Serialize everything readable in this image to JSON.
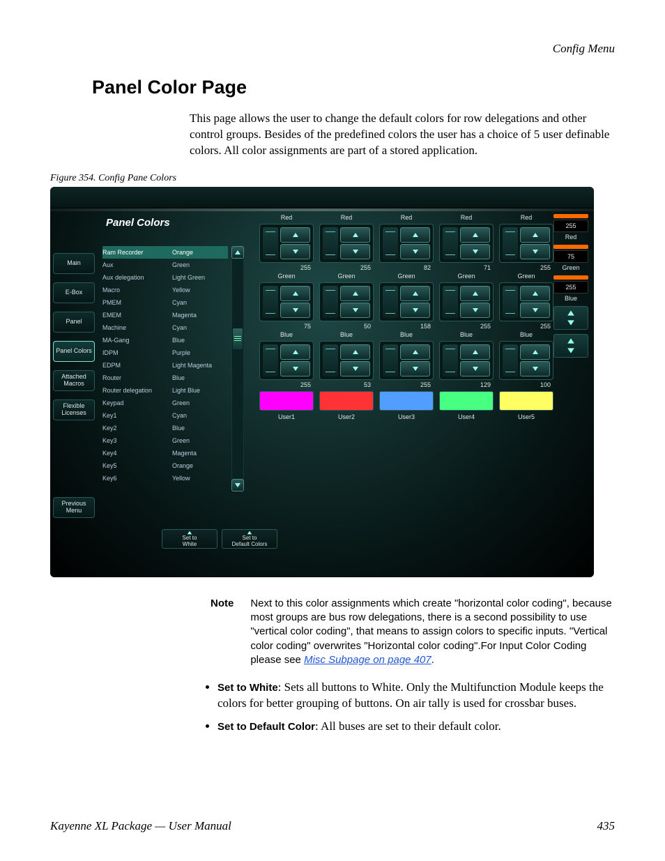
{
  "header": "Config Menu",
  "title": "Panel Color Page",
  "intro": "This page allows the user to change the default colors for row delegations and other control groups. Besides of the predefined colors the user has a choice of 5 user definable colors. All color assignments are part of a stored application.",
  "figure_caption": "Figure 354.  Config Pane Colors",
  "shot": {
    "panel_title": "Panel Colors",
    "left_tabs": [
      "Main",
      "E-Box",
      "Panel",
      "Panel Colors",
      "Attached Macros",
      "Flexible Licenses"
    ],
    "prev_tab": "Previous Menu",
    "list": [
      {
        "name": "Ram Recorder",
        "color": "Orange",
        "hi": true
      },
      {
        "name": "Aux",
        "color": "Green"
      },
      {
        "name": "Aux delegation",
        "color": "Light Green"
      },
      {
        "name": "Macro",
        "color": "Yellow"
      },
      {
        "name": "PMEM",
        "color": "Cyan"
      },
      {
        "name": "EMEM",
        "color": "Magenta"
      },
      {
        "name": "Machine",
        "color": "Cyan"
      },
      {
        "name": "MA-Gang",
        "color": "Blue"
      },
      {
        "name": "IDPM",
        "color": "Purple"
      },
      {
        "name": "EDPM",
        "color": "Light Magenta"
      },
      {
        "name": "Router",
        "color": "Blue"
      },
      {
        "name": "Router delegation",
        "color": "Light Blue"
      },
      {
        "name": "Keypad",
        "color": "Green"
      },
      {
        "name": "Key1",
        "color": "Cyan"
      },
      {
        "name": "Key2",
        "color": "Blue"
      },
      {
        "name": "Key3",
        "color": "Green"
      },
      {
        "name": "Key4",
        "color": "Magenta"
      },
      {
        "name": "Key5",
        "color": "Orange"
      },
      {
        "name": "Key6",
        "color": "Yellow"
      }
    ],
    "channels": [
      "Red",
      "Green",
      "Blue"
    ],
    "mixers": [
      {
        "r": 255,
        "g": 75,
        "b": 255
      },
      {
        "r": 255,
        "g": 50,
        "b": 53
      },
      {
        "r": 82,
        "g": 158,
        "b": 255
      },
      {
        "r": 71,
        "g": 255,
        "b": 129
      },
      {
        "r": 255,
        "g": 255,
        "b": 100
      }
    ],
    "swatches": [
      {
        "label": "User1",
        "color": "#ff00ff"
      },
      {
        "label": "User2",
        "color": "#ff3235"
      },
      {
        "label": "User3",
        "color": "#529eff"
      },
      {
        "label": "User4",
        "color": "#47ff81"
      },
      {
        "label": "User5",
        "color": "#ffff64"
      }
    ],
    "readouts": [
      {
        "bar": "#ff6a00",
        "val": "255",
        "lab": "Red"
      },
      {
        "bar": "#ff6a00",
        "val": "75",
        "lab": "Green"
      },
      {
        "bar": "#ff6a00",
        "val": "255",
        "lab": "Blue"
      }
    ],
    "bottom_buttons": [
      "Set to\nWhite",
      "Set to\nDefault Colors"
    ]
  },
  "note_label": "Note",
  "note_text_1": "Next to this color assignments which create \"horizontal color coding\", because most groups are bus row delegations, there is a second possibility to use \"vertical color coding\", that means to assign colors to specific inputs. \"Vertical color coding\" overwrites \"Horizontal color coding\".For Input Color Coding please see ",
  "note_link": "Misc Subpage",
  "note_text_2": " on page 407",
  "bullets": [
    {
      "b": "Set to White",
      "t": ": Sets all buttons to White. Only the Multifunction Module keeps the colors for better grouping of buttons. On air tally is used for crossbar buses."
    },
    {
      "b": "Set to Default Color",
      "t": ": All buses are set to their default color."
    }
  ],
  "footer_left": "Kayenne XL Package — User Manual",
  "footer_right": "435"
}
